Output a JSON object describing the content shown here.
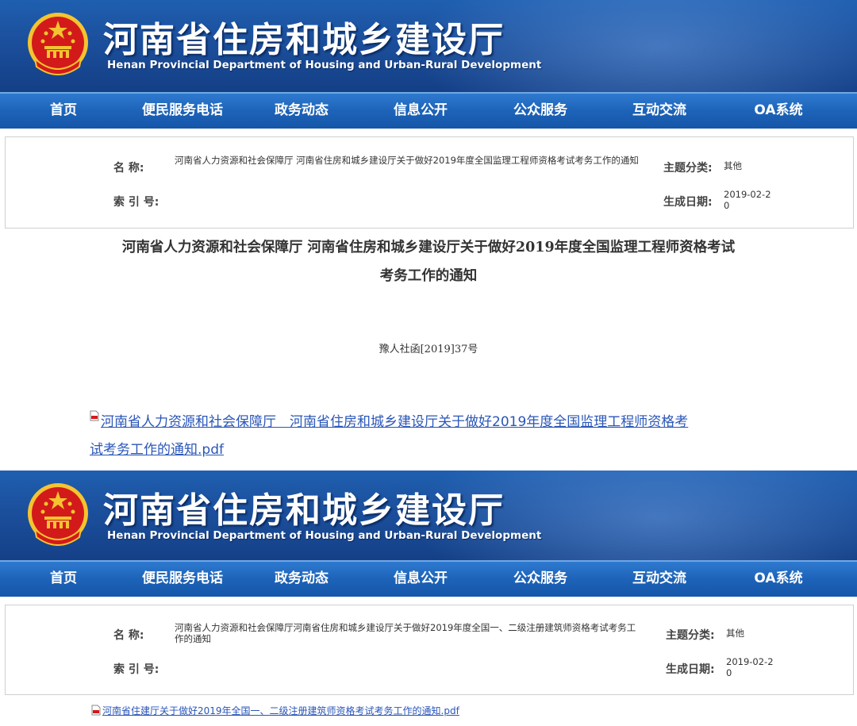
{
  "colors": {
    "banner": "#1b4f9c",
    "nav": "#1d63b8",
    "link": "#2a56b8",
    "emblem_red": "#d31a1a",
    "emblem_gold": "#f4c430"
  },
  "header": {
    "title": "河南省住房和城乡建设厅",
    "subtitle": "Henan Provincial Department of Housing and Urban-Rural Development",
    "emblem_icon": "national-emblem-icon"
  },
  "nav": [
    "首页",
    "便民服务电话",
    "政务动态",
    "信息公开",
    "公众服务",
    "互动交流",
    "OA系统"
  ],
  "labels": {
    "name": "名    称:",
    "index": "索 引 号:",
    "category": "主题分类:",
    "date": "生成日期:"
  },
  "notice1": {
    "name": "河南省人力资源和社会保障厅 河南省住房和城乡建设厅关于做好2019年度全国监理工程师资格考试考务工作的通知",
    "index": "",
    "category": "其他",
    "date": "2019-02-20",
    "title_line1": "河南省人力资源和社会保障厅 河南省住房和城乡建设厅关于做好2019年度全国监理工程师资格考试",
    "title_line2": "考务工作的通知",
    "doc_number": "豫人社函[2019]37号",
    "attachment_line1": "河南省人力资源和社会保障厅　河南省住房和城乡建设厅关于做好2019年度全国监理工程师资格考",
    "attachment_line2": "试考务工作的通知.pdf"
  },
  "notice2": {
    "name": "河南省人力资源和社会保障厅河南省住房和城乡建设厅关于做好2019年度全国一、二级注册建筑师资格考试考务工作的通知",
    "index": "",
    "category": "其他",
    "date": "2019-02-20",
    "attachment": "河南省住建厅关于做好2019年全国一、二级注册建筑师资格考试考务工作的通知.pdf"
  }
}
